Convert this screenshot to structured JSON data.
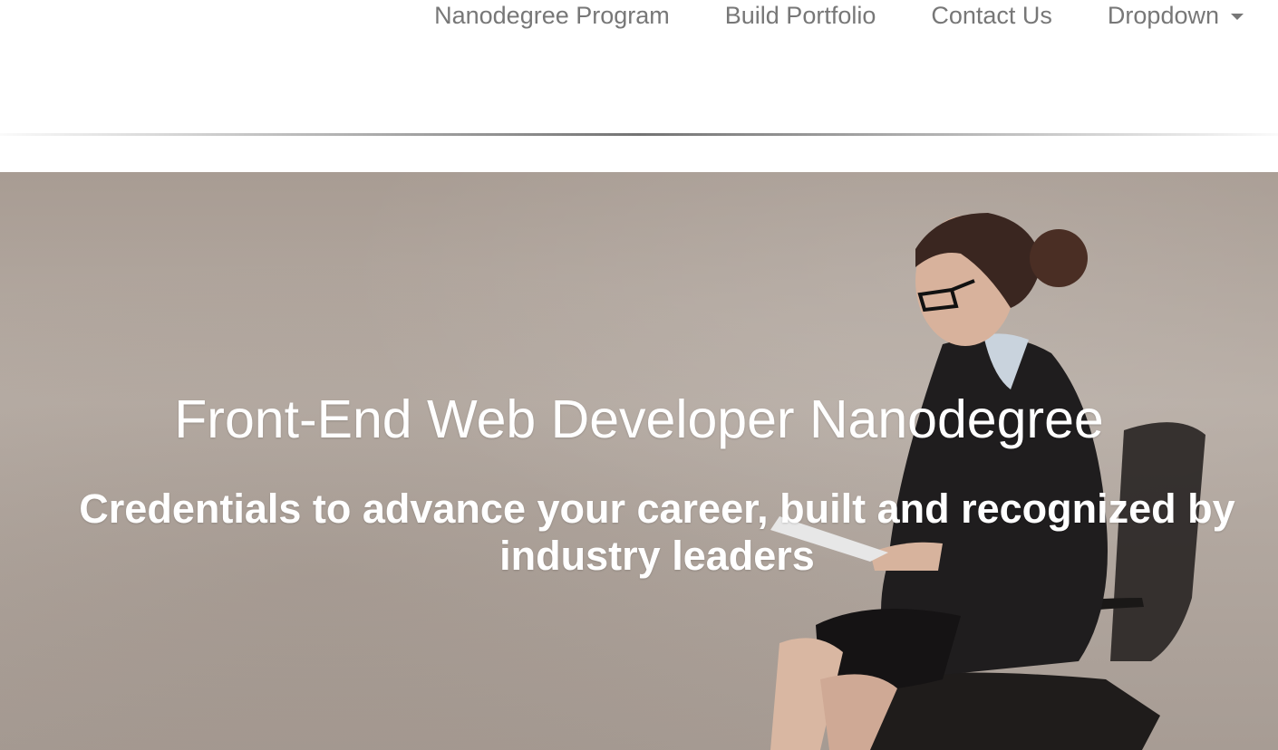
{
  "nav": {
    "items": [
      {
        "label": "Nanodegree Program"
      },
      {
        "label": "Build Portfolio"
      },
      {
        "label": "Contact Us"
      },
      {
        "label": "Dropdown"
      }
    ]
  },
  "hero": {
    "title": "Front-End Web Developer Nanodegree",
    "subtitle": "Credentials to advance your career, built and recognized by industry leaders"
  },
  "colors": {
    "nav_text": "#777777",
    "hero_text": "#ffffff"
  }
}
